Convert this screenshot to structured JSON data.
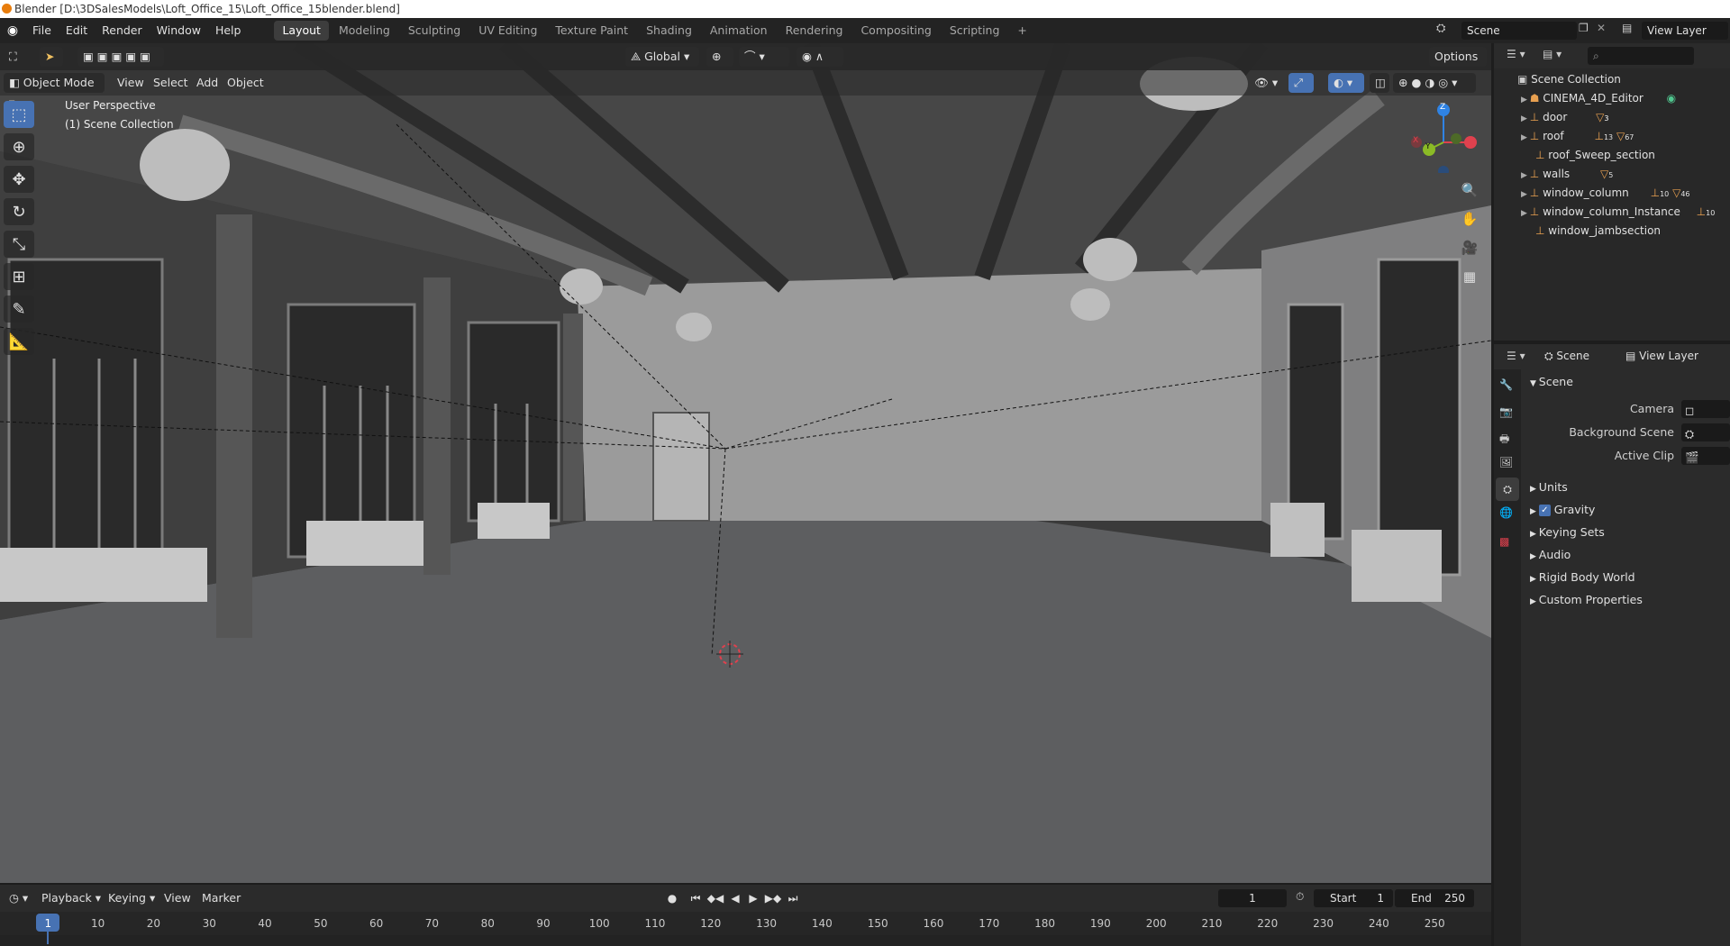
{
  "window": {
    "title": "Blender [D:\\3DSalesModels\\Loft_Office_15\\Loft_Office_15blender.blend]"
  },
  "menus": [
    "File",
    "Edit",
    "Render",
    "Window",
    "Help"
  ],
  "workspaces": [
    "Layout",
    "Modeling",
    "Sculpting",
    "UV Editing",
    "Texture Paint",
    "Shading",
    "Animation",
    "Rendering",
    "Compositing",
    "Scripting"
  ],
  "topbar": {
    "scene": "Scene",
    "view_layer": "View Layer",
    "add_tab": "+"
  },
  "viewport": {
    "transform_orientation": "Global",
    "options": "Options",
    "mode": "Object Mode",
    "menus": [
      "View",
      "Select",
      "Add",
      "Object"
    ],
    "overlay_text": [
      "User Perspective",
      "(1) Scene Collection"
    ],
    "gizmo": {
      "z": "Z",
      "y": "Y",
      "x": "X"
    }
  },
  "outliner": {
    "root": "Scene Collection",
    "items": [
      {
        "name": "CINEMA_4D_Editor",
        "badge": ""
      },
      {
        "name": "door",
        "badge": "3"
      },
      {
        "name": "roof",
        "badge": "13",
        "badge2": "67"
      },
      {
        "name": "roof_Sweep_section",
        "badge": ""
      },
      {
        "name": "walls",
        "badge": "5"
      },
      {
        "name": "window_column",
        "badge": "10",
        "badge2": "46"
      },
      {
        "name": "window_column_Instance",
        "badge": "10"
      },
      {
        "name": "window_jambsection",
        "badge": ""
      }
    ]
  },
  "properties": {
    "header_scene": "Scene",
    "header_view_layer": "View Layer",
    "panel_title": "Scene",
    "fields": [
      {
        "label": "Camera"
      },
      {
        "label": "Background Scene"
      },
      {
        "label": "Active Clip"
      }
    ],
    "sections": [
      "Units",
      "Gravity",
      "Keying Sets",
      "Audio",
      "Rigid Body World",
      "Custom Properties"
    ]
  },
  "timeline": {
    "menus": [
      "Playback",
      "Keying",
      "View",
      "Marker"
    ],
    "current_frame": "1",
    "start_label": "Start",
    "start": "1",
    "end_label": "End",
    "end": "250",
    "ticks": [
      "1",
      "10",
      "20",
      "30",
      "40",
      "50",
      "60",
      "70",
      "80",
      "90",
      "100",
      "110",
      "120",
      "130",
      "140",
      "150",
      "160",
      "170",
      "180",
      "190",
      "200",
      "210",
      "220",
      "230",
      "240",
      "250"
    ]
  },
  "colors": {
    "accent": "#4772b3",
    "blender_orange": "#e87d0d",
    "gizmo_x": "#e0414e",
    "gizmo_y": "#8bbb26",
    "gizmo_z": "#2f83e4"
  }
}
